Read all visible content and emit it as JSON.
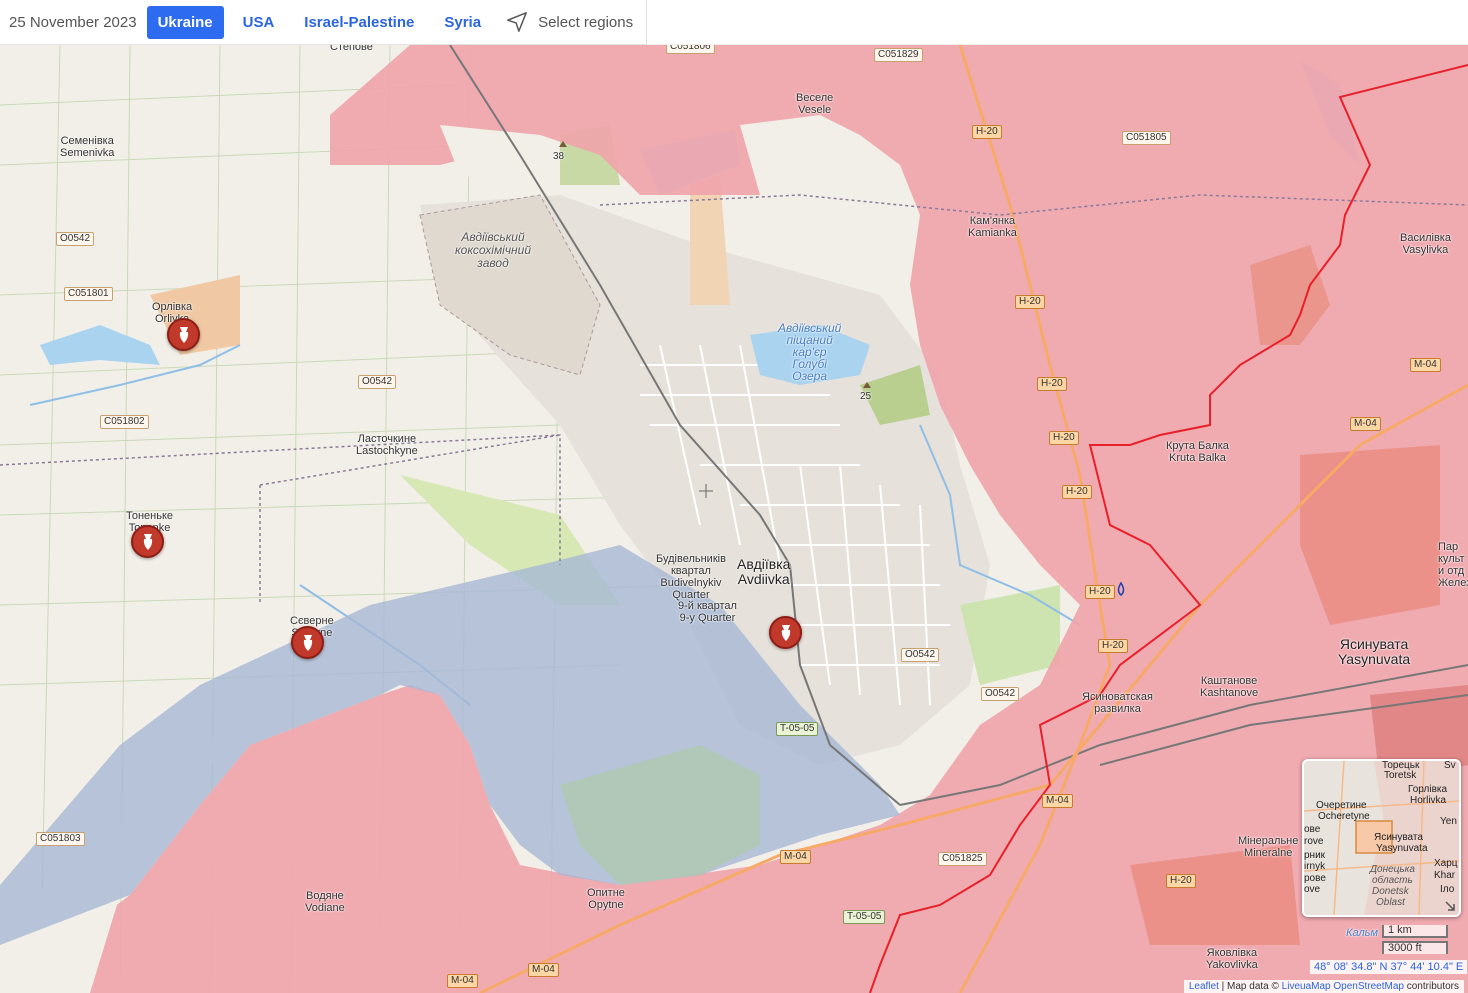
{
  "header": {
    "date": "25 November 2023",
    "tabs": [
      {
        "label": "Ukraine",
        "active": true
      },
      {
        "label": "USA",
        "active": false
      },
      {
        "label": "Israel-Palestine",
        "active": false
      },
      {
        "label": "Syria",
        "active": false
      }
    ],
    "select_regions": "Select regions"
  },
  "colors": {
    "russian_control": "#f0a3ab",
    "contested": "#a6b8d4",
    "ukraine_control": "#f2efe9",
    "border_line": "#e8202a",
    "brand": "#2d6cf0"
  },
  "map": {
    "settlements": {
      "semenivka_uk": "Семенівка",
      "semenivka": "Semenivka",
      "orlivka_uk": "Орлівка",
      "orlivka": "Orlivka",
      "lastochkyne_uk": "Ласточкине",
      "lastochkyne": "Lastochkyne",
      "tonenke_uk": "Тоненьке",
      "tonenke": "Tonenke",
      "severne_uk": "Сєверне",
      "severne": "Severne",
      "vesele_uk": "Веселе",
      "vesele": "Vesele",
      "kamianka_uk": "Кам'янка",
      "kamianka": "Kamianka",
      "vasylivka_uk": "Василівка",
      "vasylivka": "Vasylivka",
      "kruta_balka_uk": "Крута Балка",
      "kruta_balka": "Kruta Balka",
      "avdiivka_uk": "Авдіївка",
      "avdiivka": "Avdiivka",
      "budivelnykiv_1": "Будівельників",
      "budivelnykiv_2": "квартал",
      "budivelnykiv_3": "Budivelnykiv",
      "budivelnykiv_4": "Quarter",
      "quarter9_uk": "9-й квартал",
      "quarter9": "9-y Quarter",
      "kashtanove_uk": "Каштанове",
      "kashtanove": "Kashtanove",
      "yasynuvata_uk": "Ясинувата",
      "yasynuvata": "Yasynuvata",
      "razvilka_1": "Ясиноватская",
      "razvilka_2": "развилка",
      "vodiane_uk": "Водяне",
      "vodiane": "Vodiane",
      "opytne_uk": "Опитне",
      "opytne": "Opytne",
      "mineralne_uk": "Мінеральне",
      "mineralne": "Mineralne",
      "yakovlivka_uk": "Яковлівка",
      "yakovlivka": "Yakovlivka",
      "stepove_partial": "Степове",
      "edge_1": "Пар",
      "edge_2": "культ",
      "edge_3": "и отд",
      "edge_4": "Железнодо"
    },
    "features": {
      "coke_plant_1": "Авдіївський",
      "coke_plant_2": "коксохімічний",
      "coke_plant_3": "завод",
      "quarry_1": "Авдіївський",
      "quarry_2": "піщаний",
      "quarry_3": "кар'єр",
      "quarry_4": "Голубі",
      "quarry_5": "Озера",
      "peak_38": "38",
      "peak_25": "25"
    },
    "roads": {
      "o0542": "O0542",
      "c051801": "C051801",
      "c051802": "C051802",
      "c051803": "C051803",
      "c051805": "C051805",
      "c051806": "C051806",
      "c051825": "C051825",
      "c051829": "C051829",
      "h20": "H-20",
      "m04": "M-04",
      "t0505": "T-05-05"
    },
    "minimap_labels": {
      "toretsk_uk": "Торецьк",
      "toretsk": "Toretsk",
      "horlivka_uk": "Горлівка",
      "horlivka": "Horlivka",
      "ocheretyne_uk": "Очеретине",
      "ocheretyne": "Ocheretyne",
      "yasynuvata_uk": "Ясинувата",
      "yasynuvata": "Yasynuvata",
      "donetsk_obl_1": "Донецька",
      "donetsk_obl_2": "область",
      "donetsk_obl_3": "Donetsk",
      "donetsk_obl_4": "Oblast",
      "left_1": "ове",
      "left_2": "rove",
      "left_3": "рник",
      "left_4": "irnyk",
      "left_5": "рове",
      "left_6": "ove",
      "right_1": "Sv",
      "right_2": "Yen",
      "right_3": "Харц",
      "right_4": "Khar",
      "right_5": "Іло"
    },
    "scale": {
      "km": "1 km",
      "ft": "3000 ft"
    },
    "coordinates": "48° 08' 34.8\" N 37° 44' 10.4\" E",
    "attribution": {
      "leaflet": "Leaflet",
      "sep": " | Map data © ",
      "liveua": "LiveuaMap",
      "osm": "OpenStreetMap",
      "contrib": " contributors"
    },
    "kalmius_partial": "Кальм"
  }
}
